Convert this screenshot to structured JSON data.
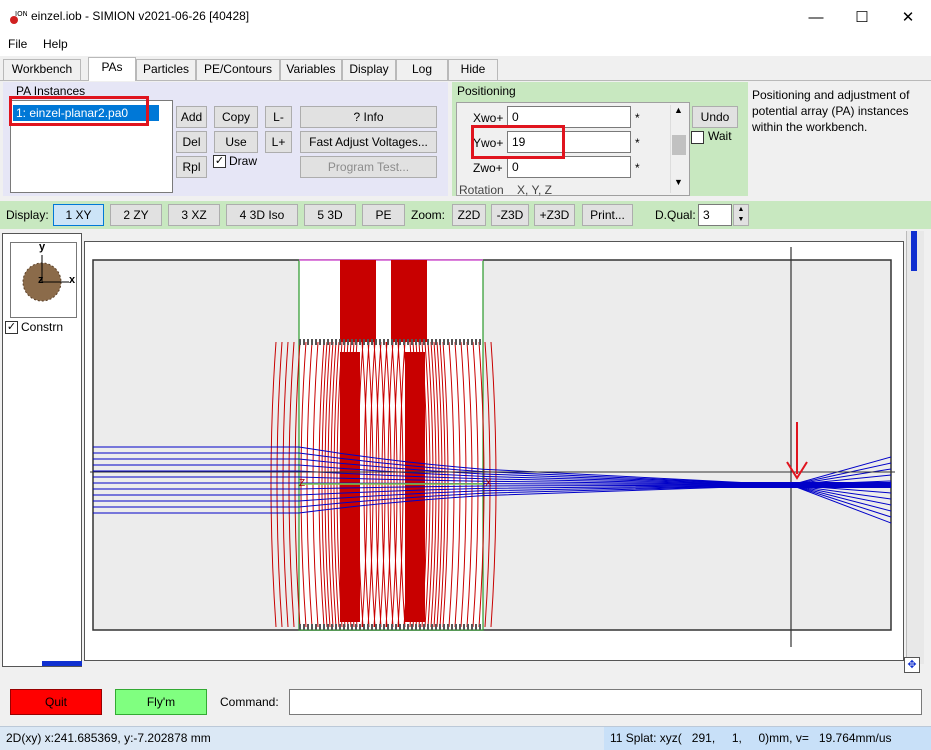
{
  "window": {
    "title": "einzel.iob - SIMION v2021-06-26 [40428]",
    "minimize": "—",
    "maximize": "☐",
    "close": "✕"
  },
  "menu": {
    "file": "File",
    "help": "Help"
  },
  "tabs": [
    "Workbench",
    "PAs",
    "Particles",
    "PE/Contours",
    "Variables",
    "Display",
    "Log",
    "Hide"
  ],
  "pa_instances": {
    "header": "PA Instances",
    "items": [
      "1: einzel-planar2.pa0"
    ]
  },
  "pa_buttons": {
    "add": "Add",
    "copy": "Copy",
    "l_minus": "L-",
    "del": "Del",
    "use": "Use",
    "l_plus": "L+",
    "rpl": "Rpl",
    "draw": "Draw",
    "info": "? Info",
    "fast_adjust": "Fast Adjust Voltages...",
    "program_test": "Program Test..."
  },
  "positioning": {
    "header": "Positioning",
    "xwo_label": "Xwo+",
    "xwo_value": "0",
    "ywo_label": "Ywo+",
    "ywo_value": "19",
    "zwo_label": "Zwo+",
    "zwo_value": "0",
    "star": "*",
    "undo": "Undo",
    "wait": "Wait",
    "partial_row": "Rotation    X, Y, Z"
  },
  "help_text": "Positioning and adjustment of potential array (PA) instances within the workbench.",
  "toolbar": {
    "display_label": "Display:",
    "xy": "1 XY",
    "zy": "2 ZY",
    "xz": "3 XZ",
    "iso": "4 3D Iso",
    "d3": "5 3D",
    "pe": "PE",
    "zoom_label": "Zoom:",
    "z2d": "Z2D",
    "mz3d": "-Z3D",
    "pz3d": "+Z3D",
    "print": "Print...",
    "dqual_label": "D.Qual:",
    "dqual_value": "3"
  },
  "view": {
    "axis_y": "y",
    "axis_x": "x",
    "axis_z": "z",
    "constrn": "Constrn",
    "lens_label_left": "Z",
    "lens_label_right": "X"
  },
  "bottom": {
    "quit": "Quit",
    "flym": "Fly'm",
    "command_label": "Command:",
    "command_value": ""
  },
  "status": {
    "left": "2D(xy) x:241.685369, y:-7.202878 mm",
    "right": "11 Splat: xyz(   291,     1,     0)mm, v=   19.764mm/us"
  },
  "colors": {
    "accent_red": "#e0141e",
    "quit_bg": "#ff0000",
    "flym_bg": "#80ff80",
    "contour": "#c80000",
    "trajectory": "#0000c8",
    "green_panel": "#c8e8c0"
  }
}
